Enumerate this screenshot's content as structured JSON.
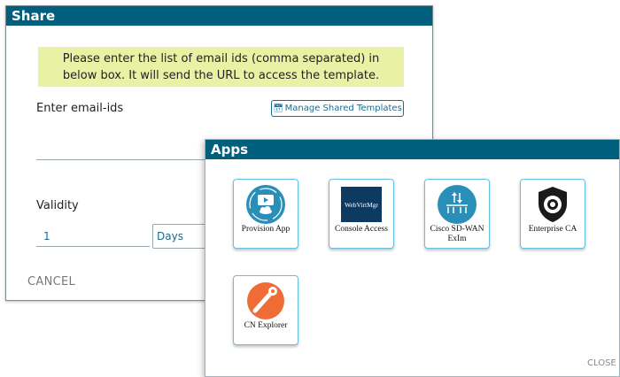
{
  "share": {
    "title": "Share",
    "notice": "Please enter the list of email ids (comma separated) in below box. It will send the URL to access the template.",
    "email_label": "Enter email-ids",
    "manage_button": "Manage Shared Templates",
    "manage_icon": "calendar-icon",
    "email_value": "",
    "validity_label": "Validity",
    "validity_value": "1",
    "validity_unit": "Days",
    "cancel_label": "CANCEL"
  },
  "apps": {
    "title": "Apps",
    "items": [
      {
        "label": "Provision App",
        "icon": "provision-app-icon"
      },
      {
        "label": "Console Access",
        "icon": "webvirtmgr-logo",
        "logo_text": "WebVirtMgr"
      },
      {
        "label": "Cisco SD-WAN ExIm",
        "icon": "cisco-sdwan-icon"
      },
      {
        "label": "Enterprise CA",
        "icon": "shield-icon"
      },
      {
        "label": "CN Explorer",
        "icon": "postman-icon"
      }
    ],
    "close_label": "CLOSE"
  },
  "colors": {
    "header": "#005f7d",
    "notice_bg": "#e8f1a4",
    "tile_border": "#69bfe2",
    "teal_icon": "#2a8fb8"
  }
}
